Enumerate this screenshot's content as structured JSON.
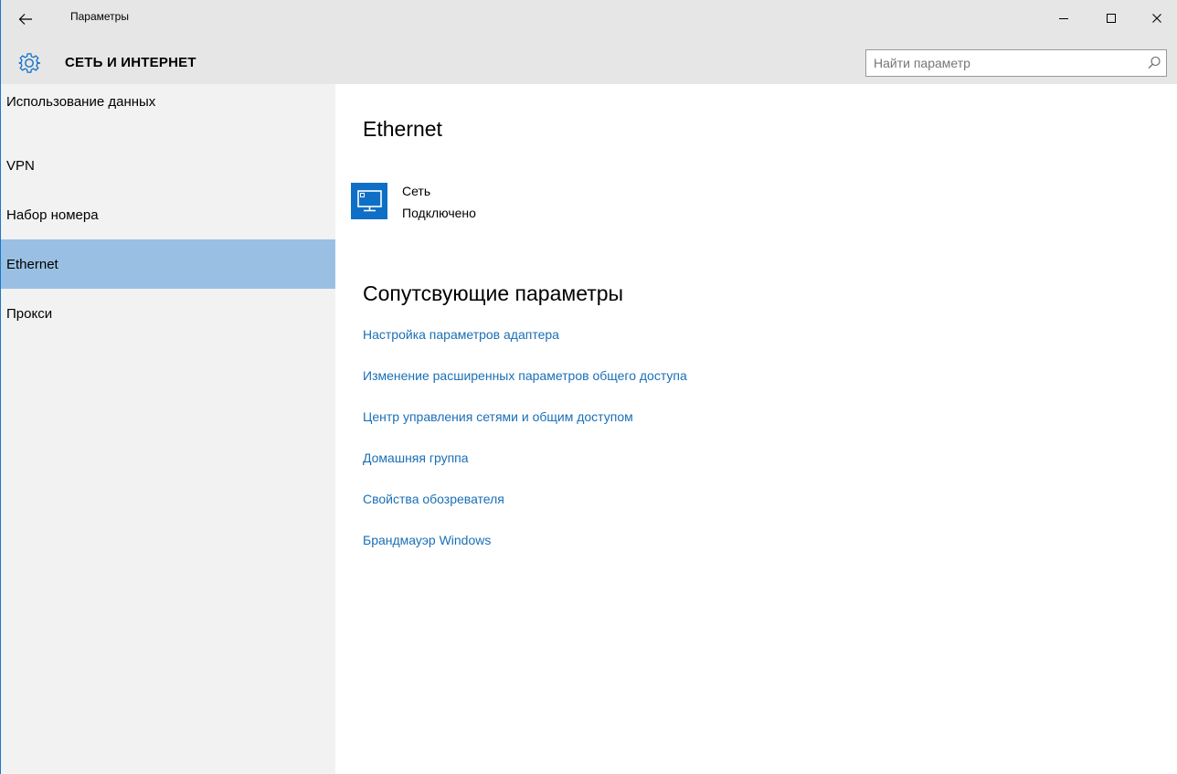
{
  "window": {
    "title": "Параметры"
  },
  "header": {
    "section_title": "СЕТЬ И ИНТЕРНЕТ",
    "search": {
      "placeholder": "Найти параметр",
      "value": ""
    }
  },
  "sidebar": {
    "items": [
      {
        "label": "Использование данных",
        "selected": false
      },
      {
        "label": "VPN",
        "selected": false
      },
      {
        "label": "Набор номера",
        "selected": false
      },
      {
        "label": "Ethernet",
        "selected": true
      },
      {
        "label": "Прокси",
        "selected": false
      }
    ]
  },
  "main": {
    "title": "Ethernet",
    "network": {
      "icon": "monitor-network-icon",
      "name": "Сеть",
      "status": "Подключено"
    },
    "related": {
      "title": "Сопутсвующие параметры",
      "links": [
        "Настройка параметров адаптера",
        "Изменение расширенных параметров общего доступа",
        "Центр управления сетями и общим доступом",
        "Домашняя группа",
        "Свойства обозревателя",
        "Брандмауэр Windows"
      ]
    }
  },
  "colors": {
    "titlebar_bg": "#e6e6e6",
    "sidebar_bg": "#f2f2f2",
    "selected_bg": "#99c0e3",
    "accent": "#0f6fc6",
    "link": "#1a6fb6"
  }
}
